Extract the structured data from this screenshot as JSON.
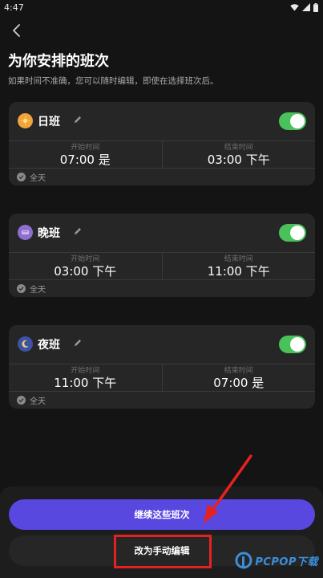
{
  "status_bar": {
    "time": "4:47"
  },
  "header": {
    "title": "为你安排的班次",
    "subtitle": "如果时间不准确，您可以随时编辑，即使在选择班次后。"
  },
  "shifts": [
    {
      "name": "日班",
      "icon": "sun-icon",
      "icon_color": "#f2a33a",
      "enabled": true,
      "start_label": "开始时间",
      "start_value": "07:00 是",
      "end_label": "结束时间",
      "end_value": "03:00 下午",
      "all_day_label": "全天"
    },
    {
      "name": "晚班",
      "icon": "evening-icon",
      "icon_color": "#8e6fd0",
      "enabled": true,
      "start_label": "开始时间",
      "start_value": "03:00 下午",
      "end_label": "结束时间",
      "end_value": "11:00 下午",
      "all_day_label": "全天"
    },
    {
      "name": "夜班",
      "icon": "moon-icon",
      "icon_color": "#3e53a8",
      "enabled": true,
      "start_label": "开始时间",
      "start_value": "11:00 下午",
      "end_label": "结束时间",
      "end_value": "07:00 是",
      "all_day_label": "全天"
    }
  ],
  "actions": {
    "continue_label": "继续这些班次",
    "manual_edit_label": "改为手动编辑"
  },
  "watermark": {
    "text": "PCPOP下载"
  },
  "colors": {
    "background": "#141414",
    "card": "#262626",
    "toggle_on": "#4ac25c",
    "primary": "#5848e0",
    "annotation": "#e5221f",
    "watermark": "#3b8fd9"
  }
}
